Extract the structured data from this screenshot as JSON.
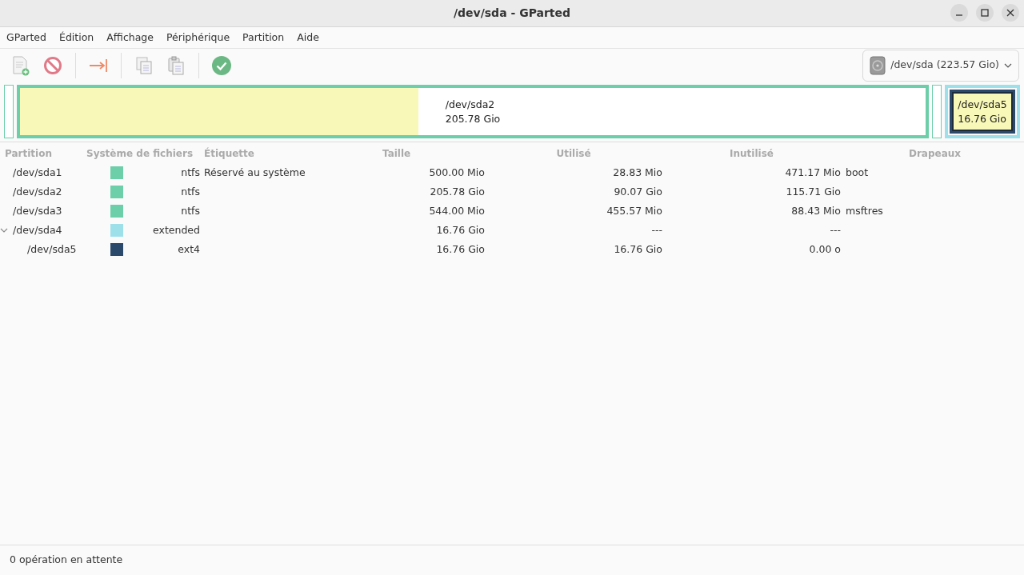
{
  "window": {
    "title": "/dev/sda - GParted"
  },
  "menu": [
    "GParted",
    "Édition",
    "Affichage",
    "Périphérique",
    "Partition",
    "Aide"
  ],
  "toolbar": [
    {
      "kind": "new"
    },
    {
      "kind": "delete"
    },
    {
      "kind": "separator"
    },
    {
      "kind": "resize"
    },
    {
      "kind": "separator"
    },
    {
      "kind": "copy"
    },
    {
      "kind": "paste"
    },
    {
      "kind": "separator"
    },
    {
      "kind": "apply"
    }
  ],
  "device": {
    "name": "/dev/sda",
    "size": "(223.57 Gio)"
  },
  "disk_map": [
    {
      "kind": "partition",
      "color": "#6ccfa9",
      "selected": false
    },
    {
      "kind": "partition",
      "color": "#6ccfa9",
      "level": 0.44,
      "label": "/dev/sda2",
      "size": "205.78 Gio",
      "selected": false
    },
    {
      "kind": "partition",
      "color": "#6ccfa9",
      "selected": false
    },
    {
      "kind": "extended",
      "color": "#9ee0ea",
      "children": [
        {
          "kind": "partition",
          "color": "#2b4a6b",
          "level": 1,
          "label": "/dev/sda5",
          "size": "16.76 Gio",
          "selected": true
        }
      ]
    }
  ],
  "table": {
    "columns": [
      "Partition",
      "Système de fichiers",
      "Étiquette",
      "Taille",
      "Utilisé",
      "Inutilisé",
      "Drapeaux"
    ],
    "rows": [
      {
        "partition": "/dev/sda1",
        "color": "#6ccfa9",
        "filesystem": "ntfs",
        "label": "Réservé au système",
        "size": "500.00 Mio",
        "used": "28.83 Mio",
        "unused": "471.17 Mio",
        "flags": "boot"
      },
      {
        "partition": "/dev/sda2",
        "color": "#6ccfa9",
        "filesystem": "ntfs",
        "size": "205.78 Gio",
        "used": "90.07 Gio",
        "unused": "115.71 Gio"
      },
      {
        "partition": "/dev/sda3",
        "color": "#6ccfa9",
        "filesystem": "ntfs",
        "size": "544.00 Mio",
        "used": "455.57 Mio",
        "unused": "88.43 Mio",
        "flags": "msftres"
      },
      {
        "partition": "/dev/sda4",
        "color": "#9ee0ea",
        "filesystem": "extended",
        "size": "16.76 Gio",
        "used": "---",
        "unused": "---",
        "expanded": true,
        "children": [
          {
            "partition": "/dev/sda5",
            "color": "#2b4a6b",
            "filesystem": "ext4",
            "size": "16.76 Gio",
            "used": "16.76 Gio",
            "unused": "0.00 o"
          }
        ]
      }
    ]
  },
  "status_bar": "0 opération en attente"
}
